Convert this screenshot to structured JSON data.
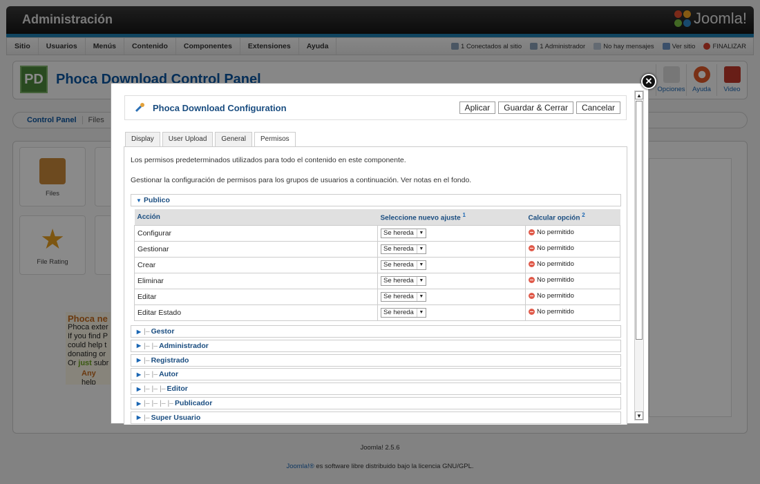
{
  "header": {
    "title": "Administración",
    "logo_text": "Joomla!"
  },
  "menu": {
    "items": [
      "Sitio",
      "Usuarios",
      "Menús",
      "Contenido",
      "Componentes",
      "Extensiones",
      "Ayuda"
    ],
    "status": {
      "connected": "1 Conectados al sitio",
      "admin": "1 Administrador",
      "messages": "No hay mensajes",
      "view_site": "Ver sitio",
      "logout": "FINALIZAR"
    }
  },
  "panel": {
    "logo": "PD",
    "title": "Phoca Download Control Panel",
    "toolbar": {
      "options": "Opciones",
      "help": "Ayuda",
      "video": "Video"
    },
    "subnav": [
      "Control Panel",
      "Files"
    ],
    "tiles": [
      "Files",
      "File Rating"
    ],
    "side_text": {
      "heading": "Phoca ne",
      "line1": "Phoca exter",
      "line2": "If you find P",
      "line3": "could help t",
      "line4": "donating or",
      "line5_prefix": "Or ",
      "line5_highlight": "just",
      "line5_suffix": " subr",
      "line6_highlight": "Any",
      "line6_suffix": " help"
    }
  },
  "footer": {
    "version": "Joomla! 2.5.6",
    "license_link": "Joomla!®",
    "license_text": " es software libre distribuido bajo la licencia GNU/GPL."
  },
  "modal": {
    "title": "Phoca Download Configuration",
    "buttons": {
      "apply": "Aplicar",
      "save_close": "Guardar & Cerrar",
      "cancel": "Cancelar"
    },
    "tabs": [
      "Display",
      "User Upload",
      "General",
      "Permisos"
    ],
    "active_tab": "Permisos",
    "intro1": "Los permisos predeterminados utilizados para todo el contenido en este componente.",
    "intro2": "Gestionar la configuración de permisos para los grupos de usuarios a continuación. Ver notas en el fondo.",
    "public_group": "Publico",
    "table": {
      "headers": {
        "action": "Acción",
        "select": "Seleccione nuevo ajuste",
        "select_note": "1",
        "calc": "Calcular opción",
        "calc_note": "2"
      },
      "rows": [
        {
          "action": "Configurar",
          "setting": "Se hereda",
          "calc": "No permitido"
        },
        {
          "action": "Gestionar",
          "setting": "Se hereda",
          "calc": "No permitido"
        },
        {
          "action": "Crear",
          "setting": "Se hereda",
          "calc": "No permitido"
        },
        {
          "action": "Eliminar",
          "setting": "Se hereda",
          "calc": "No permitido"
        },
        {
          "action": "Editar",
          "setting": "Se hereda",
          "calc": "No permitido"
        },
        {
          "action": "Editar Estado",
          "setting": "Se hereda",
          "calc": "No permitido"
        }
      ]
    },
    "groups": [
      {
        "label": "Gestor",
        "tree": "|–"
      },
      {
        "label": "Administrador",
        "tree": "|– |–"
      },
      {
        "label": "Registrado",
        "tree": "|–"
      },
      {
        "label": "Autor",
        "tree": "|– |–"
      },
      {
        "label": "Editor",
        "tree": "|– |– |–"
      },
      {
        "label": "Publicador",
        "tree": "|– |– |– |–"
      },
      {
        "label": "Super Usuario",
        "tree": "|–"
      }
    ]
  }
}
